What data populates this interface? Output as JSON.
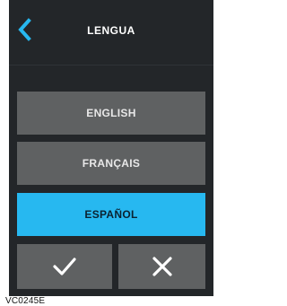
{
  "header": {
    "title": "LENGUA",
    "back_icon": "chevron-left-icon",
    "accent": "#27b8f0"
  },
  "languages": [
    {
      "label": "ENGLISH",
      "selected": false
    },
    {
      "label": "FRANÇAIS",
      "selected": false
    },
    {
      "label": "ESPAÑOL",
      "selected": true
    }
  ],
  "actions": {
    "confirm_icon": "checkmark-icon",
    "cancel_icon": "close-icon"
  },
  "caption": "VC0245E"
}
